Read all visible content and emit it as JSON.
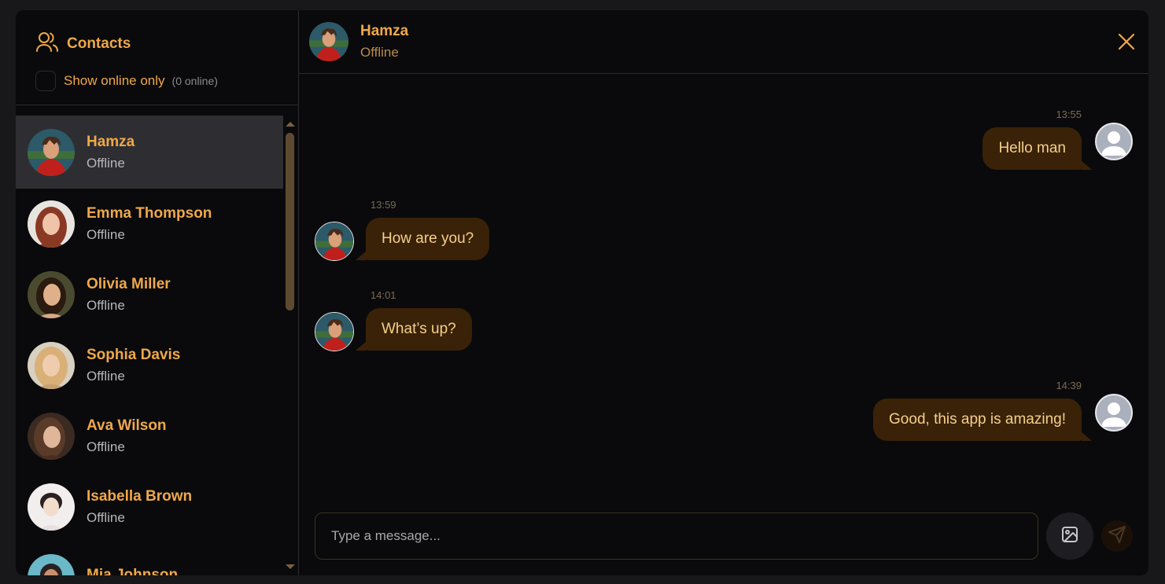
{
  "sidebar": {
    "title": "Contacts",
    "title_icon": "users-icon",
    "online_filter_label": "Show online only",
    "online_count": "(0 online)",
    "contacts": [
      {
        "name": "Hamza",
        "status": "Offline",
        "active": true
      },
      {
        "name": "Emma Thompson",
        "status": "Offline"
      },
      {
        "name": "Olivia Miller",
        "status": "Offline"
      },
      {
        "name": "Sophia Davis",
        "status": "Offline"
      },
      {
        "name": "Ava Wilson",
        "status": "Offline"
      },
      {
        "name": "Isabella Brown",
        "status": "Offline"
      },
      {
        "name": "Mia Johnson",
        "status": ""
      }
    ]
  },
  "chat": {
    "name": "Hamza",
    "status": "Offline",
    "close_icon": "close-icon",
    "messages": [
      {
        "direction": "out",
        "time": "13:55",
        "text": "Hello man"
      },
      {
        "direction": "in",
        "time": "13:59",
        "text": "How are you?"
      },
      {
        "direction": "in",
        "time": "14:01",
        "text": "What’s up?"
      },
      {
        "direction": "out",
        "time": "14:39",
        "text": "Good, this app is amazing!"
      }
    ]
  },
  "composer": {
    "placeholder": "Type a message...",
    "image_icon": "image-icon",
    "send_icon": "send-icon"
  },
  "colors": {
    "accent": "#f0a84a",
    "bubble": "#3a2208",
    "bubble_text": "#f5d08a",
    "panel": "#0a0a0c",
    "active_row": "#2e2e32"
  }
}
